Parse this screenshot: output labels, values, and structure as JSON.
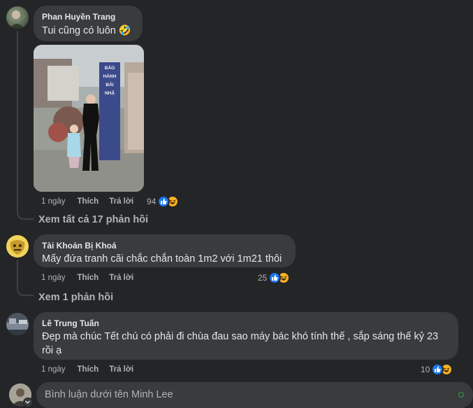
{
  "comments": [
    {
      "author": "Phan Huyền Trang",
      "text": "Tui cũng có luôn 🤣",
      "time": "1 ngày",
      "like": "Thích",
      "reply": "Trả lời",
      "reactions": "94",
      "reaction_icons": [
        "like-icon",
        "haha-icon"
      ],
      "photo_sign": [
        "BẢO",
        "HÀNH",
        "BẢI",
        "NHẬ"
      ],
      "view_replies": "Xem tất cả 17 phản hồi"
    },
    {
      "author": "Tài Khoản Bị Khoá",
      "text": "Mấy đứa tranh cãi chắc chắn toàn 1m2 với 1m21 thôi",
      "time": "1 ngày",
      "like": "Thích",
      "reply": "Trả lời",
      "reactions": "25",
      "reaction_icons": [
        "like-icon",
        "haha-icon"
      ],
      "view_replies": "Xem 1 phản hồi"
    },
    {
      "author": "Lê Trung Tuấn",
      "text_line1": "Đẹp mà chúc Tết chú có phải đi chùa đau sao máy bác khó tính thế , sắp sáng thế kỷ 23",
      "text_line2": "rồi ạ",
      "time": "1 ngày",
      "like": "Thích",
      "reply": "Trả lời",
      "reactions": "10",
      "reaction_icons": [
        "like-icon",
        "haha-icon"
      ]
    }
  ],
  "composer": {
    "placeholder": "Bình luận dưới tên Minh Lee"
  },
  "colors": {
    "background": "#242526",
    "bubble": "#3a3b3c",
    "like": "#1877f2",
    "haha": "#f7b125",
    "online": "#31a24c"
  }
}
